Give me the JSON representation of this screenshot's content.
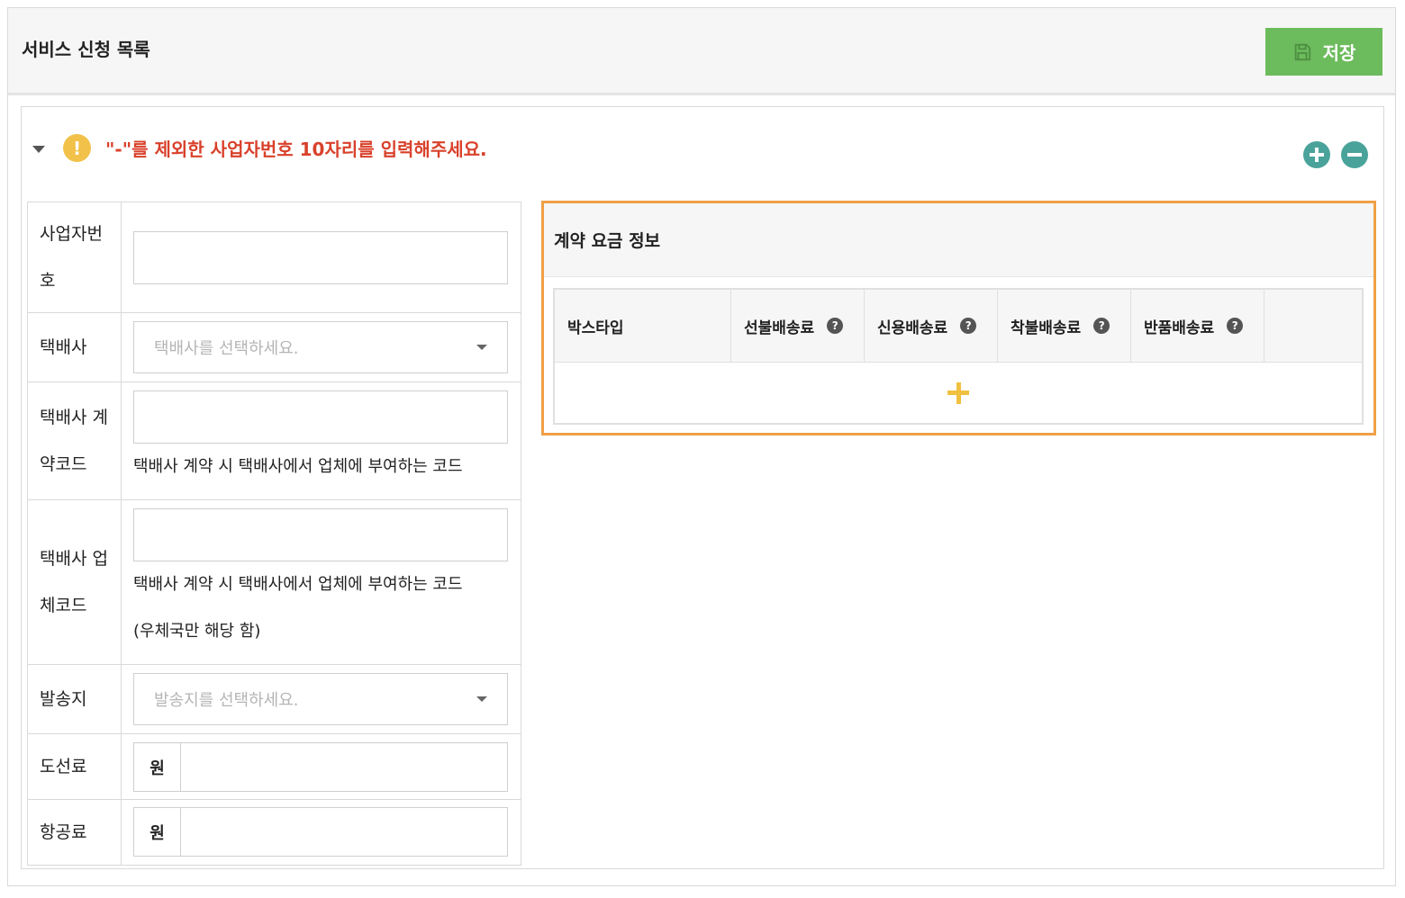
{
  "header": {
    "title": "서비스 신청 목록",
    "save_label": "저장"
  },
  "notice": {
    "text": "\"-\"를 제외한 사업자번호 10자리를 입력해주세요."
  },
  "form": {
    "business_number": {
      "label": "사업자번\n호",
      "value": ""
    },
    "courier": {
      "label": "택배사",
      "placeholder": "택배사를 선택하세요."
    },
    "contract_code": {
      "label": "택배사 계\n약코드",
      "value": "",
      "help": "택배사 계약 시 택배사에서 업체에 부여하는 코드"
    },
    "vendor_code": {
      "label": "택배사 업\n체코드",
      "value": "",
      "help1": "택배사 계약 시 택배사에서 업체에 부여하는 코드",
      "help2": "(우체국만 해당 함)"
    },
    "origin": {
      "label": "발송지",
      "placeholder": "발송지를 선택하세요."
    },
    "island_fee": {
      "label": "도선료",
      "unit": "원",
      "value": ""
    },
    "air_fee": {
      "label": "항공료",
      "unit": "원",
      "value": ""
    }
  },
  "contract": {
    "title": "계약 요금 정보",
    "columns": [
      "박스타입",
      "선불배송료",
      "신용배송료",
      "착불배송료",
      "반품배송료",
      ""
    ],
    "help_glyph": "?"
  },
  "colors": {
    "save_button": "#6cbb5c",
    "notice_text": "#d9412b",
    "warn_icon": "#f2c14a",
    "circle_buttons": "#4aa39a",
    "contract_border": "#f0a046",
    "add_row": "#f0c040"
  }
}
